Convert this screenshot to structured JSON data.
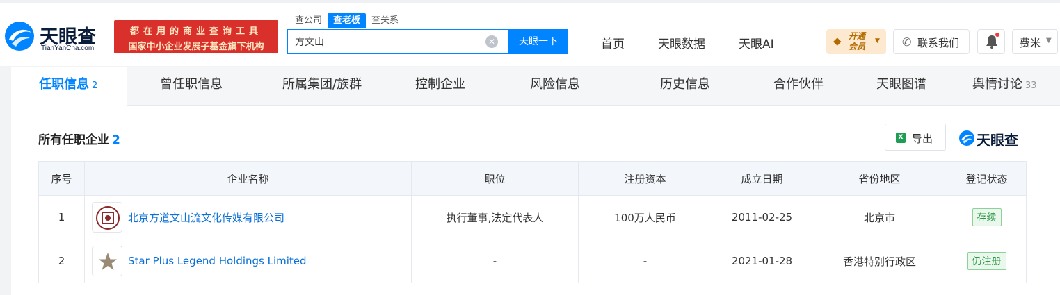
{
  "header": {
    "logo_name": "天眼查",
    "logo_sub": "TianYanCha.com",
    "ad_line1": "都在用的商业查询工具",
    "ad_line2": "国家中小企业发展子基金旗下机构",
    "search_tabs": [
      "查公司",
      "查老板",
      "查关系"
    ],
    "search_value": "方文山",
    "search_button": "天眼一下",
    "nav": [
      "首页",
      "天眼数据",
      "天眼AI"
    ],
    "vip_text": "开通会员",
    "contact_label": "联系我们",
    "user_name": "费米"
  },
  "tabs": [
    {
      "label": "任职信息",
      "count": "2"
    },
    {
      "label": "曾任职信息",
      "count": ""
    },
    {
      "label": "所属集团/族群",
      "count": ""
    },
    {
      "label": "控制企业",
      "count": ""
    },
    {
      "label": "风险信息",
      "count": ""
    },
    {
      "label": "历史信息",
      "count": ""
    },
    {
      "label": "合作伙伴",
      "count": ""
    },
    {
      "label": "天眼图谱",
      "count": ""
    },
    {
      "label": "舆情讨论",
      "count": "33"
    }
  ],
  "section": {
    "title": "所有任职企业",
    "count": "2",
    "export_label": "导出",
    "watermark": "天眼查"
  },
  "table": {
    "headers": [
      "序号",
      "企业名称",
      "职位",
      "注册资本",
      "成立日期",
      "省份地区",
      "登记状态"
    ],
    "rows": [
      {
        "index": "1",
        "name": "北京方道文山流文化传媒有限公司",
        "position": "执行董事,法定代表人",
        "capital": "100万人民币",
        "date": "2011-02-25",
        "region": "北京市",
        "status": "存续"
      },
      {
        "index": "2",
        "name": "Star Plus Legend Holdings Limited",
        "position": "-",
        "capital": "-",
        "date": "2021-01-28",
        "region": "香港特别行政区",
        "status": "仍注册"
      }
    ]
  },
  "colors": {
    "accent": "#0084ff",
    "link": "#0a6fd6",
    "status_green": "#2b9a45",
    "ad_red": "#d9302c"
  }
}
